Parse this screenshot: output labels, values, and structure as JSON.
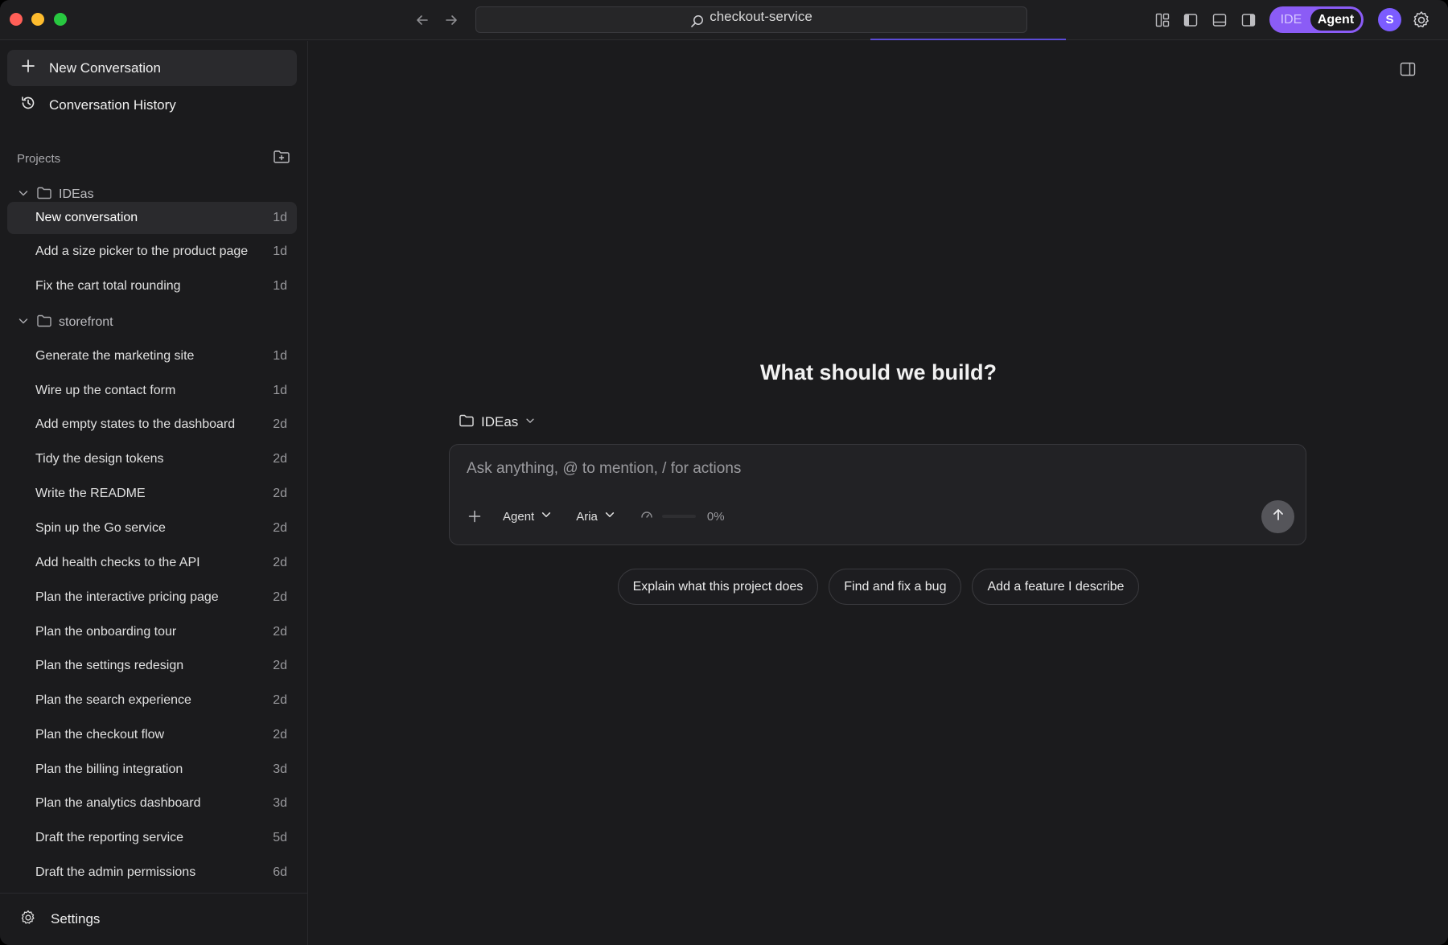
{
  "titlebar": {
    "search_text": "checkout-service",
    "mode_toggle": {
      "ide_label": "IDE",
      "agent_label": "Agent",
      "active": "Agent"
    },
    "avatar_initial": "S"
  },
  "sidebar": {
    "new_conversation_label": "New Conversation",
    "history_label": "Conversation History",
    "projects_label": "Projects",
    "projects": [
      {
        "name": "IDEas",
        "expanded": true,
        "conversations": [
          {
            "title": "New conversation",
            "age": "1d",
            "active": true
          },
          {
            "title": "Add a size picker to the product page",
            "age": "1d"
          },
          {
            "title": "Fix the cart total rounding",
            "age": "1d"
          }
        ]
      },
      {
        "name": "storefront",
        "expanded": true,
        "conversations": [
          {
            "title": "Generate the marketing site",
            "age": "1d"
          },
          {
            "title": "Wire up the contact form",
            "age": "1d"
          },
          {
            "title": "Add empty states to the dashboard",
            "age": "2d"
          },
          {
            "title": "Tidy the design tokens",
            "age": "2d"
          },
          {
            "title": "Write the README",
            "age": "2d"
          },
          {
            "title": "Spin up the Go service",
            "age": "2d"
          },
          {
            "title": "Add health checks to the API",
            "age": "2d"
          },
          {
            "title": "Plan the interactive pricing page",
            "age": "2d"
          },
          {
            "title": "Plan the onboarding tour",
            "age": "2d"
          },
          {
            "title": "Plan the settings redesign",
            "age": "2d"
          },
          {
            "title": "Plan the search experience",
            "age": "2d"
          },
          {
            "title": "Plan the checkout flow",
            "age": "2d"
          },
          {
            "title": "Plan the billing integration",
            "age": "3d"
          },
          {
            "title": "Plan the analytics dashboard",
            "age": "3d"
          },
          {
            "title": "Draft the reporting service",
            "age": "5d"
          },
          {
            "title": "Draft the admin permissions",
            "age": "6d"
          }
        ]
      }
    ],
    "settings_label": "Settings"
  },
  "main": {
    "heading": "What should we build?",
    "project_selector": "IDEas",
    "composer": {
      "placeholder": "Ask anything, @ to mention, / for actions",
      "mode": "Agent",
      "model": "Aria",
      "usage_text": "0%",
      "usage_fraction": 0
    },
    "suggestions": [
      "Explain what this project does",
      "Find and fix a bug",
      "Add a feature I describe"
    ]
  },
  "colors": {
    "accent": "#8b5cf6",
    "background": "#1b1b1d",
    "sidebar_active": "#2a2a2d"
  },
  "icons": {
    "new_conversation": "plus-icon",
    "history": "history-icon",
    "new_project": "folder-plus-icon",
    "folder": "folder-icon",
    "settings": "gear-icon"
  }
}
